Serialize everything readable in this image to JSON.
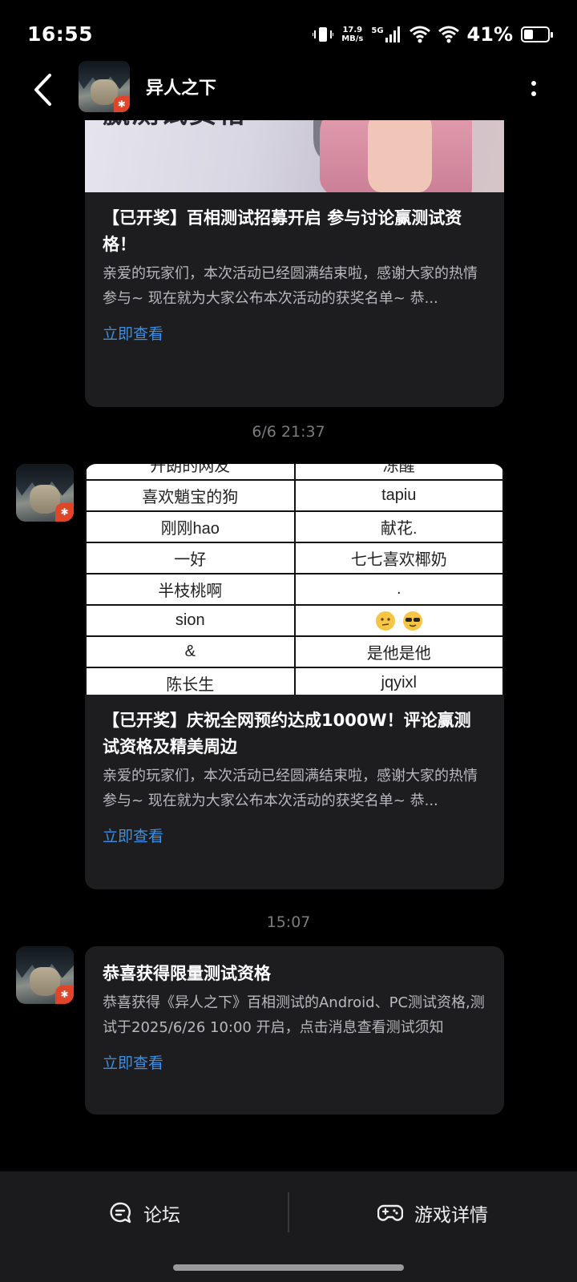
{
  "status_bar": {
    "time": "16:55",
    "net_speed_value": "17.9",
    "net_speed_unit": "MB/s",
    "network": "5G",
    "battery_percent": "41%",
    "battery_level": 0.41
  },
  "header": {
    "title": "异人之下"
  },
  "messages": [
    {
      "title": "【已开奖】百相测试招募开启 参与讨论赢测试资格！",
      "description": "亲爱的玩家们，本次活动已经圆满结束啦，感谢大家的热情参与~ 现在就为大家公布本次活动的获奖名单~ 恭...",
      "link": "立即查看",
      "banner_text": "赢测试资格"
    },
    {
      "timestamp": "6/6  21:37",
      "table_rows": [
        [
          "开朗的网友",
          "冻醒"
        ],
        [
          "喜欢魈宝的狗",
          "tapiu"
        ],
        [
          "刚刚hao",
          "献花."
        ],
        [
          "一好",
          "七七喜欢椰奶"
        ],
        [
          "半枝桃啊",
          "."
        ],
        [
          "sion",
          ""
        ],
        [
          "&",
          "是他是他"
        ],
        [
          "陈长生",
          "jqyixl"
        ]
      ],
      "title": "【已开奖】庆祝全网预约达成1000W！评论赢测试资格及精美周边",
      "description": "亲爱的玩家们，本次活动已经圆满结束啦，感谢大家的热情参与~ 现在就为大家公布本次活动的获奖名单~ 恭...",
      "link": "立即查看"
    },
    {
      "timestamp": "15:07",
      "title": "恭喜获得限量测试资格",
      "description": "恭喜获得《异人之下》百相测试的Android、PC测试资格,测试于2025/6/26 10:00 开启，点击消息查看测试须知",
      "link": "立即查看"
    }
  ],
  "bottom_tabs": {
    "forum": "论坛",
    "game_details": "游戏详情"
  },
  "colors": {
    "background": "#000000",
    "card": "#1d1d1f",
    "link": "#3c8fe3",
    "timestamp": "#7c7c80"
  }
}
